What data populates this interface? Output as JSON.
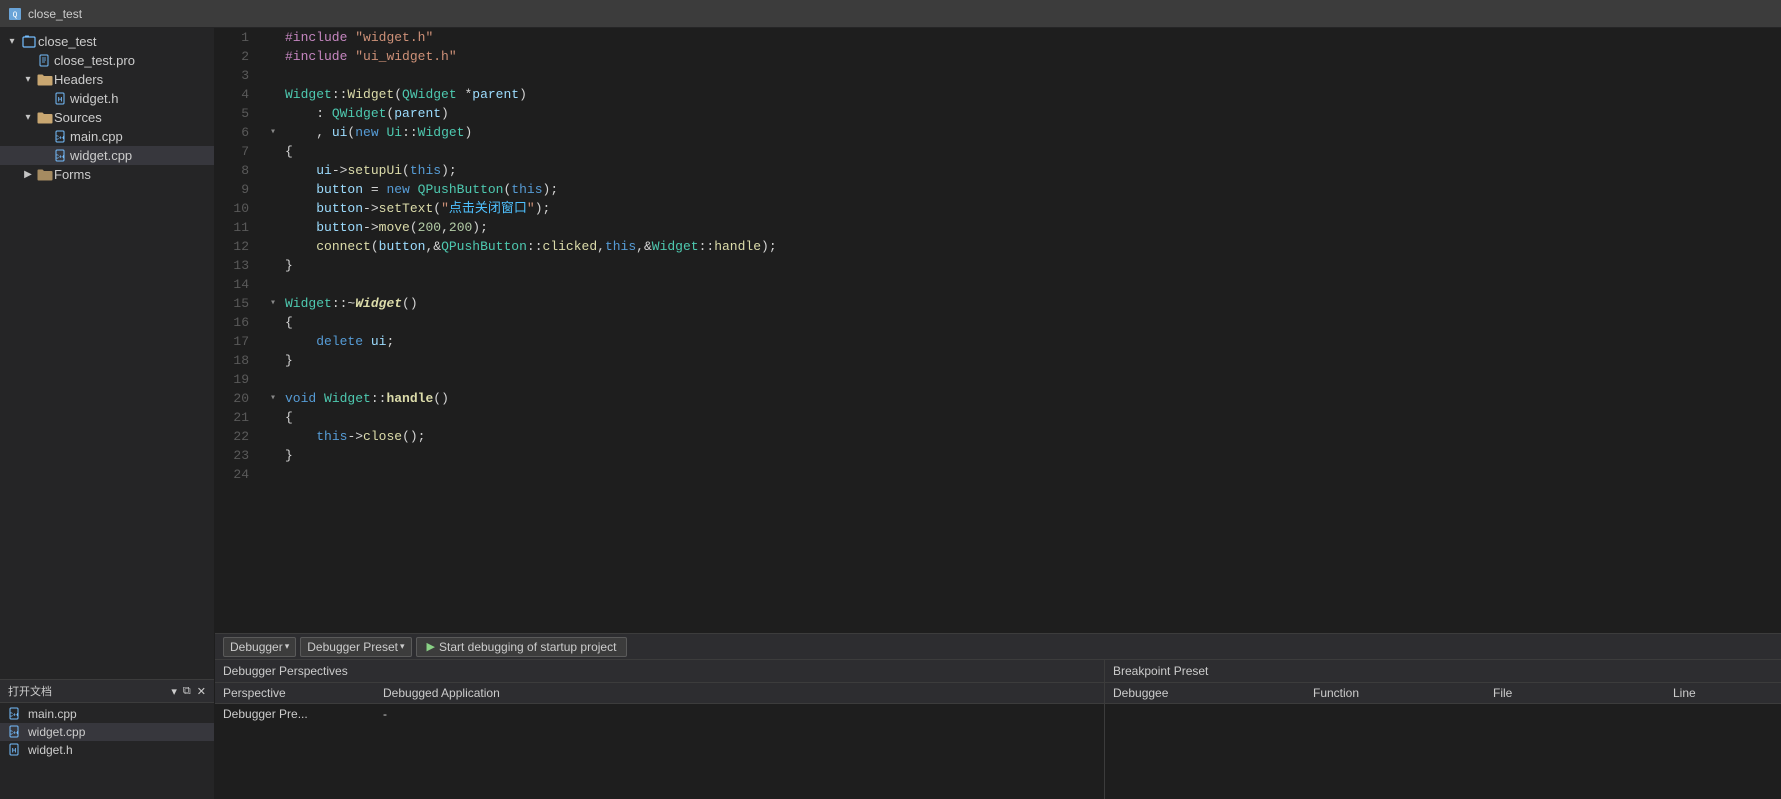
{
  "titlebar": {
    "label": "close_test"
  },
  "sidebar": {
    "items": [
      {
        "id": "root",
        "label": "close_test",
        "type": "project",
        "level": 0,
        "arrow": "▾",
        "icon": "📄"
      },
      {
        "id": "close_test_pro",
        "label": "close_test.pro",
        "type": "file",
        "level": 1,
        "arrow": "",
        "icon": "📄"
      },
      {
        "id": "headers",
        "label": "Headers",
        "type": "folder",
        "level": 1,
        "arrow": "▾",
        "icon": "📁"
      },
      {
        "id": "widget_h",
        "label": "widget.h",
        "type": "header",
        "level": 2,
        "arrow": "",
        "icon": "📄"
      },
      {
        "id": "sources",
        "label": "Sources",
        "type": "folder",
        "level": 1,
        "arrow": "▾",
        "icon": "📁"
      },
      {
        "id": "main_cpp",
        "label": "main.cpp",
        "type": "cpp",
        "level": 2,
        "arrow": "",
        "icon": "📄"
      },
      {
        "id": "widget_cpp",
        "label": "widget.cpp",
        "type": "cpp",
        "level": 2,
        "arrow": "",
        "icon": "📄",
        "selected": true
      },
      {
        "id": "forms",
        "label": "Forms",
        "type": "folder",
        "level": 1,
        "arrow": "▶",
        "icon": "📁"
      }
    ]
  },
  "open_docs": {
    "header": "打开文档",
    "items": [
      {
        "label": "main.cpp",
        "icon": "cpp"
      },
      {
        "label": "widget.cpp",
        "icon": "cpp",
        "selected": true
      },
      {
        "label": "widget.h",
        "icon": "header"
      }
    ]
  },
  "editor": {
    "filename": "widget.cpp",
    "lines": [
      {
        "num": 1,
        "fold": "",
        "code": "#include \"widget.h\"",
        "tokens": [
          {
            "t": "include",
            "v": "#include"
          },
          {
            "t": "space",
            "v": " "
          },
          {
            "t": "string",
            "v": "\"widget.h\""
          }
        ]
      },
      {
        "num": 2,
        "fold": "",
        "code": "#include \"ui_widget.h\"",
        "tokens": [
          {
            "t": "include",
            "v": "#include"
          },
          {
            "t": "space",
            "v": " "
          },
          {
            "t": "string",
            "v": "\"ui_widget.h\""
          }
        ]
      },
      {
        "num": 3,
        "fold": "",
        "code": ""
      },
      {
        "num": 4,
        "fold": "",
        "code": "Widget::Widget(QWidget *parent)"
      },
      {
        "num": 5,
        "fold": "",
        "code": "    : QWidget(parent)"
      },
      {
        "num": 6,
        "fold": "▾",
        "code": "    , ui(new Ui::Widget)"
      },
      {
        "num": 7,
        "fold": "",
        "code": "{"
      },
      {
        "num": 8,
        "fold": "",
        "code": "    ui->setupUi(this);"
      },
      {
        "num": 9,
        "fold": "",
        "code": "    button = new QPushButton(this);"
      },
      {
        "num": 10,
        "fold": "",
        "code": "    button->setText(\"点击关闭窗口\");"
      },
      {
        "num": 11,
        "fold": "",
        "code": "    button->move(200,200);"
      },
      {
        "num": 12,
        "fold": "",
        "code": "    connect(button,&QPushButton::clicked,this,&Widget::handle);"
      },
      {
        "num": 13,
        "fold": "",
        "code": "}"
      },
      {
        "num": 14,
        "fold": "",
        "code": ""
      },
      {
        "num": 15,
        "fold": "▾",
        "code": "Widget::~Widget()"
      },
      {
        "num": 16,
        "fold": "",
        "code": "{"
      },
      {
        "num": 17,
        "fold": "",
        "code": "    delete ui;"
      },
      {
        "num": 18,
        "fold": "",
        "code": "}"
      },
      {
        "num": 19,
        "fold": "",
        "code": ""
      },
      {
        "num": 20,
        "fold": "▾",
        "code": "void Widget::handle()"
      },
      {
        "num": 21,
        "fold": "",
        "code": "{"
      },
      {
        "num": 22,
        "fold": "",
        "code": "    this->close();"
      },
      {
        "num": 23,
        "fold": "",
        "code": "}"
      },
      {
        "num": 24,
        "fold": "",
        "code": ""
      }
    ]
  },
  "debugger_toolbar": {
    "debugger_label": "Debugger",
    "preset_label": "Debugger Preset",
    "start_label": "Start debugging of startup project"
  },
  "debugger_panel": {
    "left_title": "Debugger Perspectives",
    "col_perspective": "Perspective",
    "col_debugged": "Debugged Application",
    "row_perspective": "Debugger Pre...",
    "row_debugged": "-",
    "right_title": "Breakpoint Preset",
    "col_debuggee": "Debuggee",
    "col_function": "Function",
    "col_file": "File",
    "col_line": "Line"
  }
}
